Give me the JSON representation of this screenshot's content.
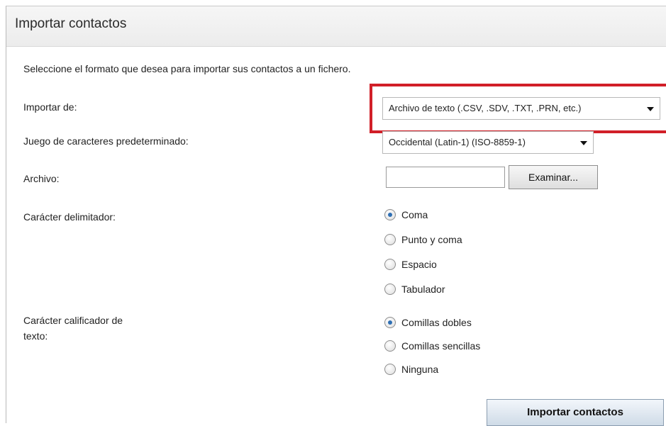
{
  "header": {
    "title": "Importar contactos"
  },
  "intro": "Seleccione el formato que desea para importar sus contactos a un fichero.",
  "fields": {
    "import_from_label": "Importar de:",
    "import_from_value": "Archivo de texto (.CSV, .SDV, .TXT, .PRN, etc.)",
    "charset_label": "Juego de caracteres predeterminado:",
    "charset_value": "Occidental (Latin-1) (ISO-8859-1)",
    "file_label": "Archivo:",
    "file_value": "",
    "browse_label": "Examinar...",
    "delimiter_label": "Carácter delimitador:",
    "delimiter_options": [
      {
        "label": "Coma",
        "checked": true
      },
      {
        "label": "Punto y coma",
        "checked": false
      },
      {
        "label": "Espacio",
        "checked": false
      },
      {
        "label": "Tabulador",
        "checked": false
      }
    ],
    "qualifier_label_line1": "Carácter calificador de",
    "qualifier_label_line2": "texto:",
    "qualifier_options": [
      {
        "label": "Comillas dobles",
        "checked": true
      },
      {
        "label": "Comillas sencillas",
        "checked": false
      },
      {
        "label": "Ninguna",
        "checked": false
      }
    ]
  },
  "actions": {
    "submit_label": "Importar contactos"
  },
  "colors": {
    "highlight": "#d11f28",
    "accent": "#2f6fb3"
  }
}
